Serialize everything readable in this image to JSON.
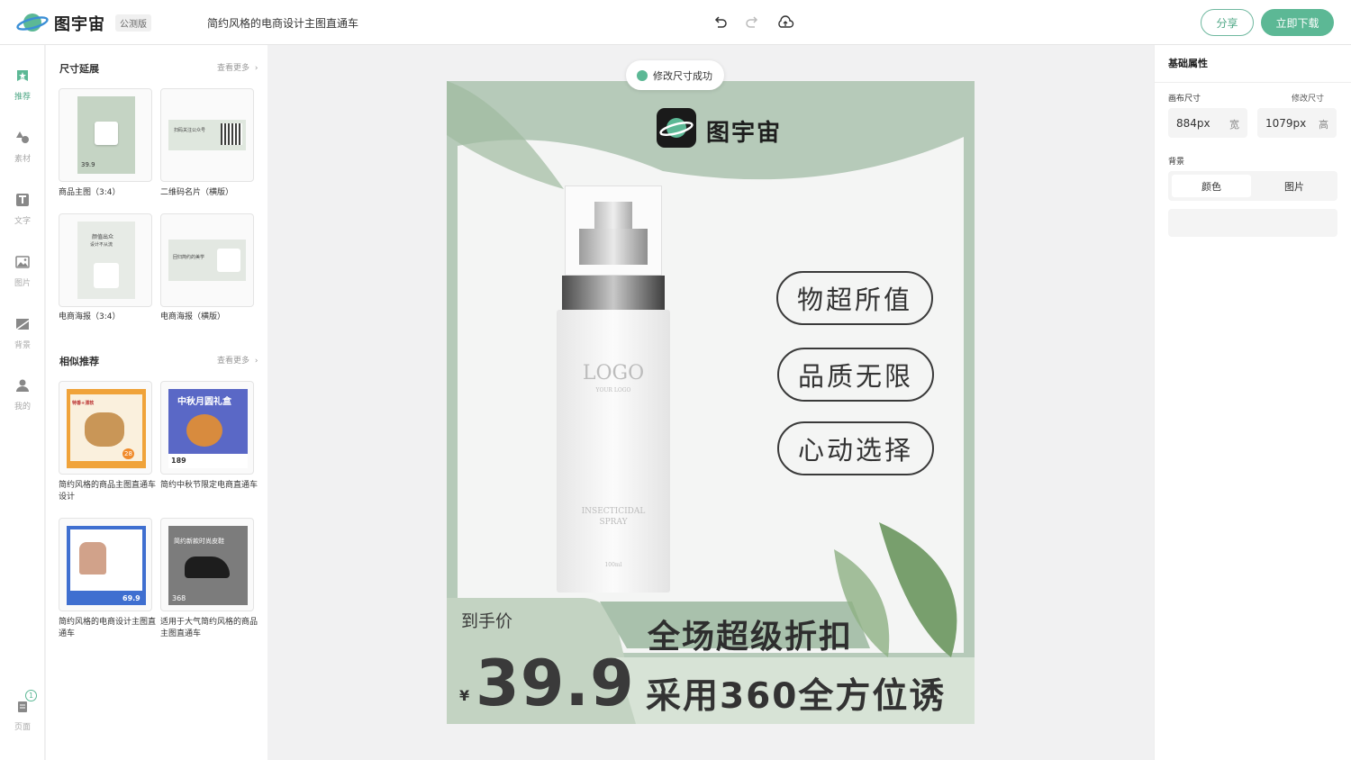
{
  "header": {
    "brand": "图宇宙",
    "badge": "公测版",
    "doc_title": "简约风格的电商设计主图直通车",
    "share_label": "分享",
    "download_label": "立即下载",
    "accent_color": "#5cb895"
  },
  "nav": {
    "items": [
      {
        "label": "推荐",
        "icon": "recommend-icon"
      },
      {
        "label": "素材",
        "icon": "material-icon"
      },
      {
        "label": "文字",
        "icon": "text-icon"
      },
      {
        "label": "图片",
        "icon": "image-icon"
      },
      {
        "label": "背景",
        "icon": "background-icon"
      },
      {
        "label": "我的",
        "icon": "user-icon"
      }
    ],
    "pages_label": "页面",
    "pages_count": "1"
  },
  "leftpanel": {
    "size_section": {
      "title": "尺寸延展",
      "more": "查看更多",
      "cards": [
        {
          "label": "商品主图（3:4）"
        },
        {
          "label": "二维码名片（横版）"
        },
        {
          "label": "电商海报（3:4）"
        },
        {
          "label": "电商海报（横版）"
        }
      ],
      "thumb_texts": {
        "qr_title": "扫码关注公众号",
        "poster_title": "颜值出众",
        "poster_sub": "设计不从流",
        "poster2_title": "回归简约的美学",
        "price_small": "39.9"
      }
    },
    "similar_section": {
      "title": "相似推荐",
      "more": "查看更多",
      "cards": [
        {
          "label": "简约风格的商品主图直通车设计"
        },
        {
          "label": "简约中秋节限定电商直通车"
        },
        {
          "label": "简约风格的电商设计主图直通车"
        },
        {
          "label": "适用于大气简约风格的商品主图直通车"
        }
      ],
      "thumb_texts": {
        "bread_badge": "特香+漂软",
        "bread_price": "28",
        "moon_title": "中秋月圆礼盒",
        "moon_price": "189",
        "chair_price": "69.9",
        "shoe_title": "简约新款时尚皮鞋",
        "shoe_price": "368"
      }
    }
  },
  "canvas": {
    "toast": "修改尺寸成功",
    "brand": "图宇宙",
    "tags": [
      "物超所值",
      "品质无限",
      "心动选择"
    ],
    "bottle_logo": "LOGO",
    "bottle_sub": "YOUR LOGO",
    "bottle_product": "INSECTICIDAL SPRAY",
    "bottle_volume": "100ml",
    "price_label": "到手价",
    "currency": "¥",
    "price": "39.9",
    "promo_line1": "全场超级折扣",
    "promo_line2": "采用360全方位诱",
    "bg_color": "#b6cab9"
  },
  "rightpanel": {
    "title": "基础属性",
    "canvas_size_label": "画布尺寸",
    "modify_size_label": "修改尺寸",
    "width_value": "884px",
    "width_unit": "宽",
    "height_value": "1079px",
    "height_unit": "高",
    "background_label": "背景",
    "bg_options": [
      "颜色",
      "图片"
    ]
  }
}
